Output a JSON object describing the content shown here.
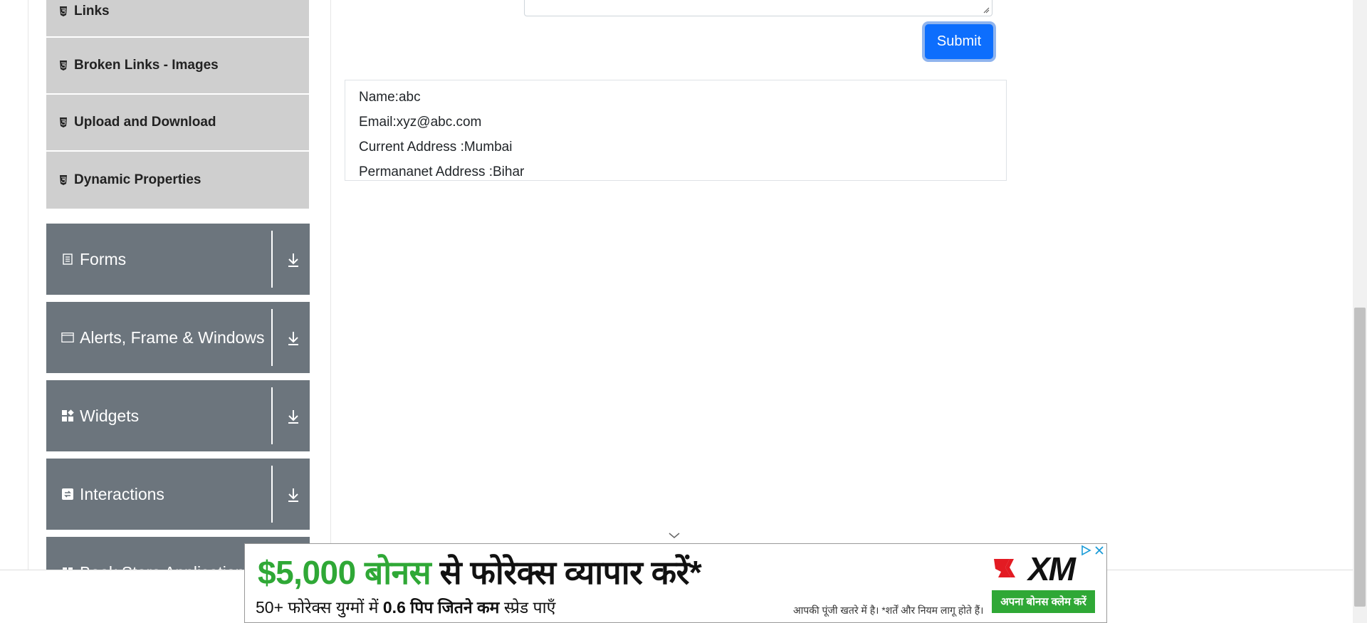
{
  "sidebar": {
    "subitems": [
      {
        "label": "Links",
        "icon": "html5-icon"
      },
      {
        "label": "Broken Links - Images",
        "icon": "html5-icon"
      },
      {
        "label": "Upload and Download",
        "icon": "html5-icon"
      },
      {
        "label": "Dynamic Properties",
        "icon": "html5-icon"
      }
    ],
    "groups": [
      {
        "label": "Forms",
        "icon": "document-icon"
      },
      {
        "label": "Alerts, Frame & Windows",
        "icon": "window-icon"
      },
      {
        "label": "Widgets",
        "icon": "widgets-icon"
      },
      {
        "label": "Interactions",
        "icon": "interactions-icon"
      },
      {
        "label": "Book Store Application",
        "icon": "book-icon"
      }
    ]
  },
  "form": {
    "submit_label": "Submit"
  },
  "output": {
    "name": "Name:abc",
    "email": "Email:xyz@abc.com",
    "current_address": "Current Address :Mumbai",
    "permanent_address": "Permananet Address :Bihar"
  },
  "ad": {
    "headline_amount": "$5,000 बोनस",
    "headline_rest": " से फोरेक्स व्यापार करें*",
    "sub_part1": "50+ फोरेक्स युग्मों में ",
    "sub_bold": "0.6 पिप जितने कम",
    "sub_part2": " स्प्रेड पाएँ",
    "disclaimer": "आपकी पूंजी खतरे में है। *शर्तें और नियम लागू होते हैं।",
    "logo_text": "XM",
    "cta": "अपना बोनस क्लेम करें",
    "colors": {
      "green": "#2fa836",
      "logo_red": "#e31b23"
    }
  },
  "colors": {
    "sidebar_group_bg": "#6c757d",
    "sidebar_subitem_bg": "#cfcfcf",
    "submit_bg": "#0d6efd"
  }
}
